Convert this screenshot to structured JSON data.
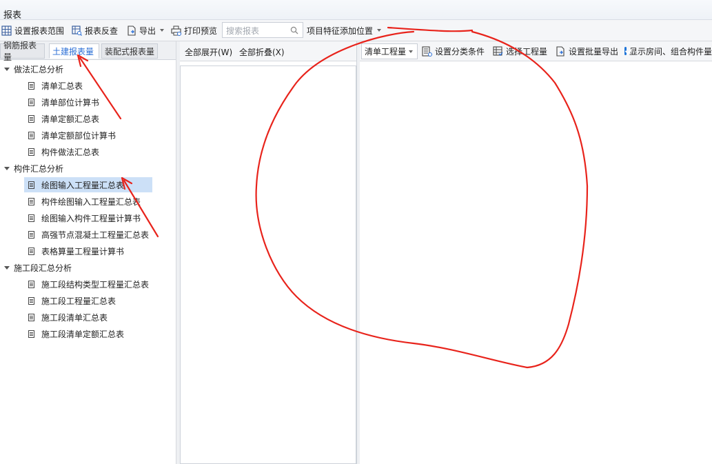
{
  "window": {
    "title": "报表"
  },
  "toolbar": {
    "set_range": "设置报表范围",
    "reverse_check": "报表反查",
    "export": "导出",
    "print_preview": "打印预览",
    "search_placeholder": "搜索报表",
    "feature_position": "项目特征添加位置"
  },
  "left": {
    "tabs": [
      {
        "label": "钢筋报表量",
        "active": false
      },
      {
        "label": "土建报表量",
        "active": true
      },
      {
        "label": "装配式报表量",
        "active": false
      }
    ],
    "groups": [
      {
        "label": "做法汇总分析",
        "items": [
          "清单汇总表",
          "清单部位计算书",
          "清单定额汇总表",
          "清单定额部位计算书",
          "构件做法汇总表"
        ]
      },
      {
        "label": "构件汇总分析",
        "items": [
          "绘图输入工程量汇总表",
          "构件绘图输入工程量汇总表",
          "绘图输入构件工程量计算书",
          "高强节点混凝土工程量汇总表",
          "表格算量工程量计算书"
        ]
      },
      {
        "label": "施工段汇总分析",
        "items": [
          "施工段结构类型工程量汇总表",
          "施工段工程量汇总表",
          "施工段清单汇总表",
          "施工段清单定额汇总表"
        ]
      }
    ],
    "selected_item": "绘图输入工程量汇总表"
  },
  "middle": {
    "expand_all": "全部展开(W)",
    "collapse_all": "全部折叠(X)"
  },
  "right": {
    "quantity_select": "清单工程量",
    "set_category": "设置分类条件",
    "select_quantity": "选择工程量",
    "batch_export": "设置批量导出",
    "show_rooms": "显示房间、组合构件量",
    "show_rooms_checked": true
  },
  "annotations": {
    "color": "#e8231b"
  },
  "colors": {
    "accent": "#2b6fd6",
    "selection": "#cce0f7",
    "checkbox": "#1e74d8"
  }
}
